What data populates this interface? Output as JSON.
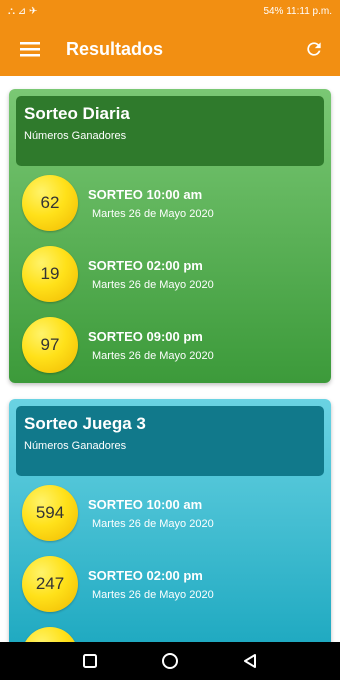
{
  "status_bar": {
    "left": "⛬ ⊿ ✈",
    "right": "54% 11:11 p.m."
  },
  "app_bar": {
    "title": "Resultados",
    "menu_icon": "hamburger-menu-icon",
    "refresh_icon": "refresh-icon"
  },
  "colors": {
    "app_bar": "#f28f12",
    "card_green": "#4aa046",
    "card_green_header": "#2f7a2c",
    "card_cyan": "#22b1c8",
    "card_cyan_header": "#11798b",
    "ball": "#ffde10"
  },
  "cards": [
    {
      "title": "Sorteo Diaria",
      "subtitle": "Números Ganadores",
      "draws": [
        {
          "number": "62",
          "label": "SORTEO 10:00 am",
          "date": "Martes 26 de Mayo 2020"
        },
        {
          "number": "19",
          "label": "SORTEO 02:00 pm",
          "date": "Martes 26 de Mayo 2020"
        },
        {
          "number": "97",
          "label": "SORTEO 09:00 pm",
          "date": "Martes 26 de Mayo 2020"
        }
      ]
    },
    {
      "title": "Sorteo Juega 3",
      "subtitle": "Números Ganadores",
      "draws": [
        {
          "number": "594",
          "label": "SORTEO 10:00 am",
          "date": "Martes 26 de Mayo 2020"
        },
        {
          "number": "247",
          "label": "SORTEO 02:00 pm",
          "date": "Martes 26 de Mayo 2020"
        }
      ]
    }
  ],
  "nav_bar": {
    "icons": [
      "recents-square-icon",
      "home-circle-icon",
      "back-triangle-icon"
    ]
  }
}
